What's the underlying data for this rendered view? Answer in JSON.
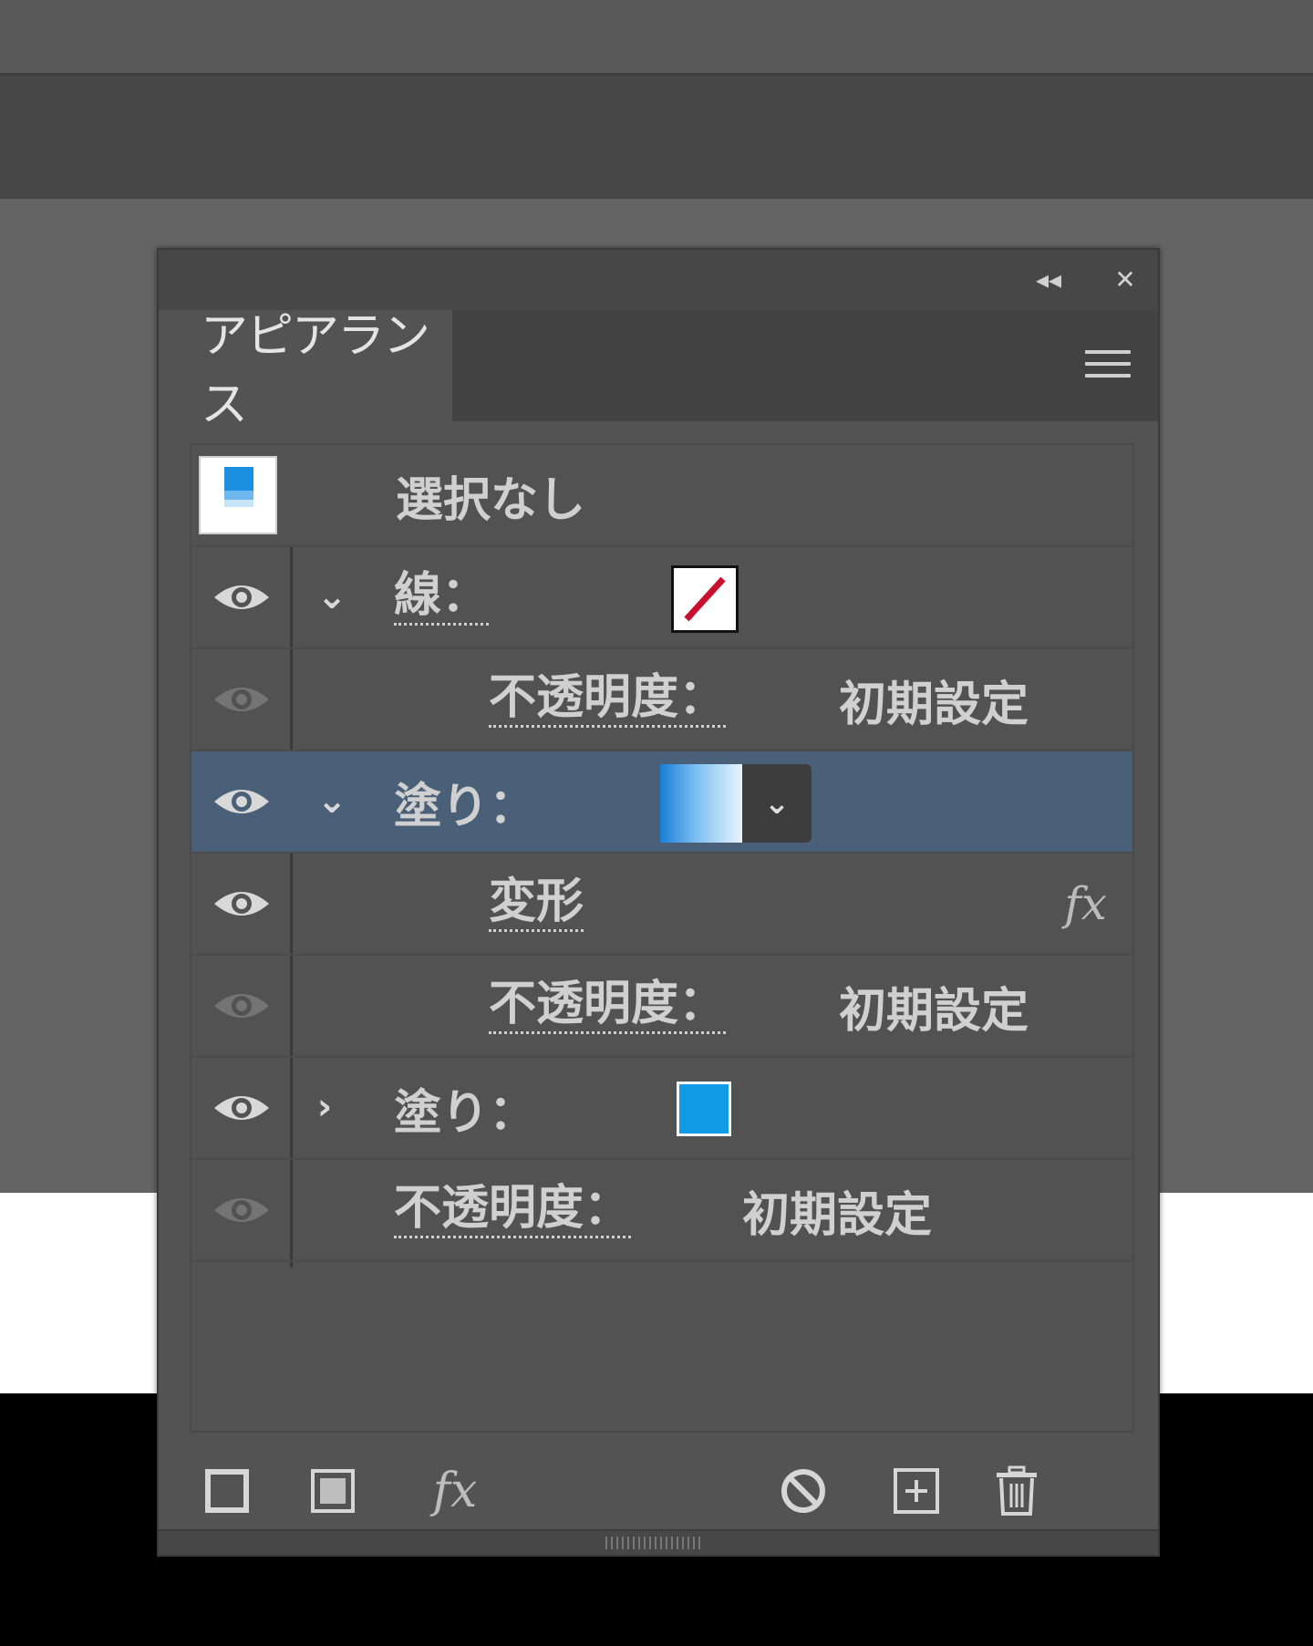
{
  "panel": {
    "tab_label": "アピアランス",
    "header_buttons": {
      "collapse": "◂◂",
      "close": "✕"
    }
  },
  "appearance": {
    "target_label": "選択なし",
    "rows": [
      {
        "label": "線：",
        "swatch": "none-stroke",
        "visible": true
      },
      {
        "label": "不透明度：",
        "value": "初期設定"
      },
      {
        "label": "塗り：",
        "swatch": "gradient",
        "visible": true,
        "selected": true
      },
      {
        "label": "変形",
        "fx": "fx"
      },
      {
        "label": "不透明度：",
        "value": "初期設定"
      },
      {
        "label": "塗り：",
        "swatch": "blue",
        "visible": true
      },
      {
        "label": "不透明度：",
        "value": "初期設定"
      }
    ]
  },
  "icons": {
    "chevron_down": "⌄",
    "chevron_right": "›",
    "fx": "fx"
  },
  "colors": {
    "selected_row": "#4a5f78",
    "gradient_start": "#1a7fd6",
    "fill_blue": "#0f9be8",
    "none_slash": "#c8102e"
  }
}
